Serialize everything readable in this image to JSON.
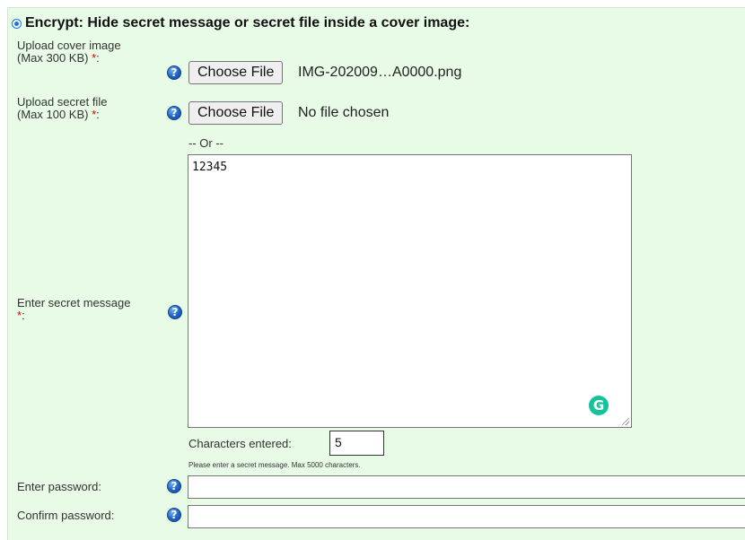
{
  "section": {
    "heading": "Encrypt: Hide secret message or secret file inside a cover image:"
  },
  "cover_image": {
    "label_line1": "Upload cover image",
    "label_line2": "(Max 300 KB)",
    "required_mark": "*",
    "label_suffix": ":",
    "button_label": "Choose File",
    "file_name": "IMG-202009…A0000.png",
    "help_glyph": "?"
  },
  "secret_file": {
    "label_line1": "Upload secret file",
    "label_line2": "(Max 100 KB)",
    "required_mark": "*",
    "label_suffix": ":",
    "button_label": "Choose File",
    "file_name": "No file chosen",
    "help_glyph": "?"
  },
  "or_separator": "-- Or --",
  "secret_message": {
    "label": "Enter secret message",
    "required_mark": "*",
    "label_suffix": ":",
    "value": "12345",
    "help_glyph": "?",
    "assistant_badge": "G"
  },
  "char_count": {
    "label": "Characters entered:",
    "value": "5",
    "hint": "Please enter a secret message. Max 5000 characters."
  },
  "password": {
    "label": "Enter password:",
    "value": "",
    "help_glyph": "?"
  },
  "confirm_password": {
    "label": "Confirm password:",
    "value": "",
    "help_glyph": "?"
  },
  "colors": {
    "panel_bg": "#e7fbe6",
    "radio": "#1a73e8",
    "required": "#dd0000",
    "help_icon": "#1f63c4",
    "grammarly": "#15c39a"
  }
}
